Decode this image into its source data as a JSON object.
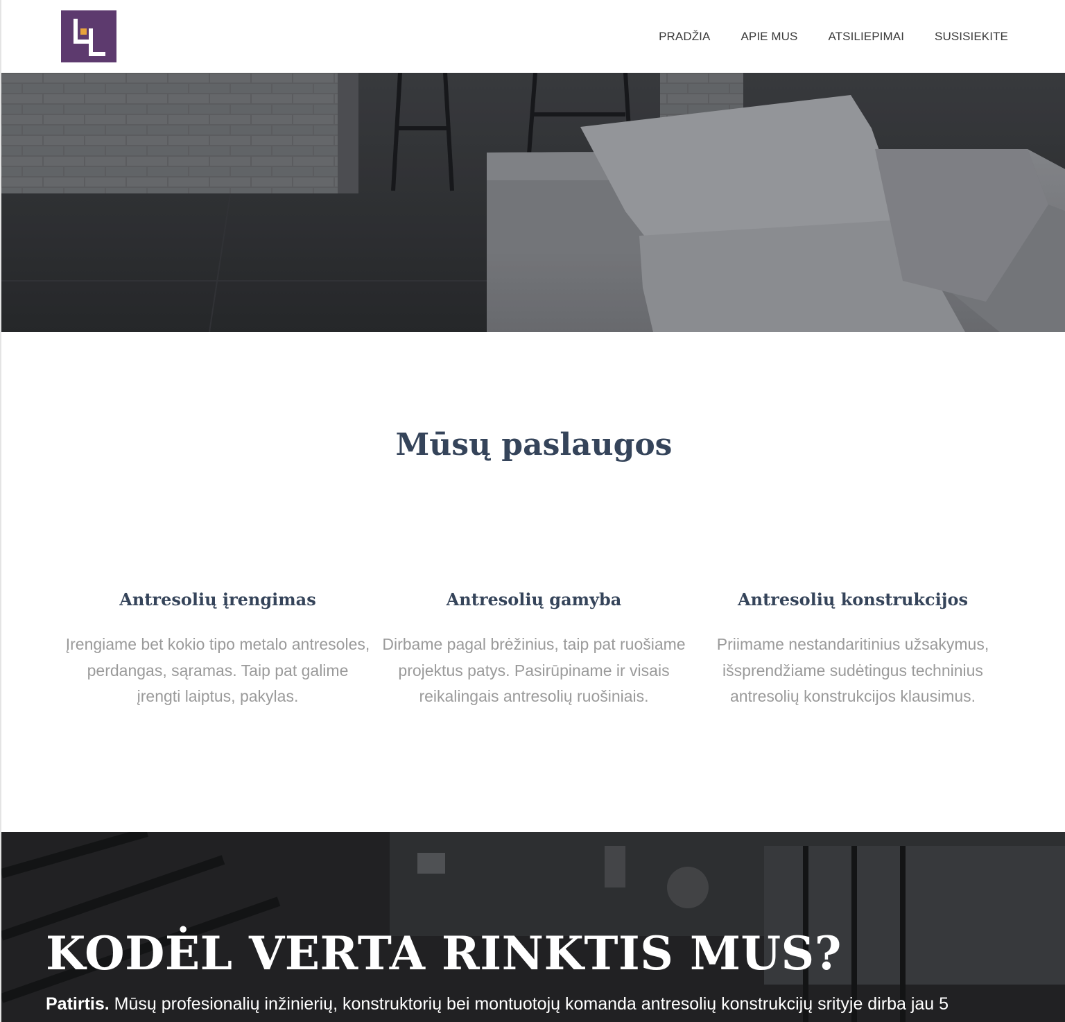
{
  "header": {
    "logo_icon": "le-monogram-logo",
    "nav": [
      {
        "label": "PRADŽIA"
      },
      {
        "label": "APIE MUS"
      },
      {
        "label": "ATSILIEPIMAI"
      },
      {
        "label": "SUSISIEKITE"
      }
    ]
  },
  "hero": {
    "image": "interior-sofa-brick-photo"
  },
  "services": {
    "title": "Mūsų paslaugos",
    "items": [
      {
        "title": "Antresolių įrengimas",
        "text": "Įrengiame bet kokio tipo metalo antresoles, perdangas, sąramas. Taip pat galime įrengti laiptus, pakylas."
      },
      {
        "title": "Antresolių gamyba",
        "text": "Dirbame pagal brėžinius, taip pat ruošiame projektus patys. Pasirūpiname ir visais reikalingais antresolių ruošiniais."
      },
      {
        "title": "Antresolių konstrukcijos",
        "text": "Priimame nestandaritinius užsakymus, išsprendžiame sudėtingus techninius antresolių konstrukcijos klausimus."
      }
    ]
  },
  "why": {
    "title": "KODĖL VERTA RINKTIS MUS?",
    "lead_bold": "Patirtis.",
    "lead_text": " Mūsų profesionalių inžinierių, konstruktorių bei montuotojų komanda antresolių konstrukcijų srityje dirba jau 5"
  },
  "colors": {
    "brand_purple": "#5d3a6e",
    "accent_orange": "#e8a33c",
    "heading": "#35445a",
    "body_text": "#9a9a9a"
  }
}
